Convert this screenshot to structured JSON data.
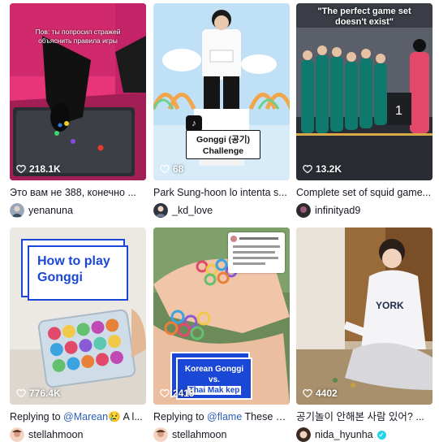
{
  "videos": [
    {
      "likes": "218.1K",
      "caption": "Это вам не 388, конечно ...",
      "author": "yenanuna",
      "overlay": "Пов: ты попросил стражей объяснить правила игры"
    },
    {
      "likes": "68",
      "caption": "Park Sung-hoon lo intenta s...",
      "author": "_kd_love",
      "overlay_title": "Gonggi (공기)",
      "overlay_sub": "Challenge"
    },
    {
      "likes": "13.2K",
      "caption": "Complete set of squid game...",
      "author": "infinityad9",
      "overlay": "\"The perfect game set doesn't exist\""
    },
    {
      "likes": "776.4K",
      "caption_prefix": "Replying to ",
      "caption_mention": "@Marean😢",
      "caption_suffix": " A l...",
      "author": "stellahmoon",
      "overlay_line1": "How to play",
      "overlay_line2": "Gonggi"
    },
    {
      "likes": "2419",
      "caption_prefix": "Replying to ",
      "caption_mention": "@flame",
      "caption_suffix": " These w...",
      "author": "stellahmoon",
      "overlay_line1": "Korean Gonggi",
      "overlay_line2": "vs.",
      "overlay_line3": "Thai Mak kep"
    },
    {
      "likes": "4402",
      "caption": "공기놀이 안해본 사람 있어? ...",
      "author": "nida_hyunha",
      "verified": true
    }
  ],
  "icons": {
    "likes": "heart-outline-icon",
    "verified": "verified-check-icon",
    "platform": "tiktok-logo-icon"
  },
  "colors": {
    "mention": "#2b5db9",
    "verified": "#20d5ec",
    "gonggi_blue": "#1a47d6"
  }
}
